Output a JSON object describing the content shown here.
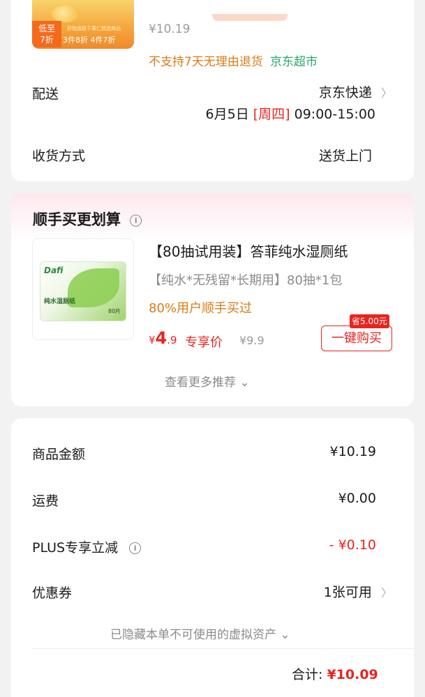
{
  "product": {
    "badge_line1": "低至",
    "badge_line2": "7折",
    "discount_text": "3件8折 4件7折",
    "tiny_text": "好物道路干果仁精选商品",
    "price": "¥10.19",
    "no_return": "不支持7天无理由退货",
    "store": "京东超市"
  },
  "delivery": {
    "label": "配送",
    "carrier": "京东快递",
    "date": "6月5日",
    "weekday": "[周四]",
    "time": "09:00-15:00",
    "method_label": "收货方式",
    "method_value": "送货上门"
  },
  "addon": {
    "section_title": "顺手买更划算",
    "info_icon": "i",
    "brand": "Dafi",
    "pack_text": "纯水湿厕纸",
    "pack_count": "80片",
    "title": "【80抽试用装】答菲纯水湿厕纸",
    "subtitle": "【纯水*无残留*长期用】80抽*1包",
    "stat": "80%用户顺手买过",
    "price_symbol": "¥",
    "price_int": "4",
    "price_dec": ".9",
    "price_label": "专享价",
    "original_price": "¥9.9",
    "buy_label": "一键购买",
    "save_tag": "省5.00元",
    "more_label": "查看更多推荐 ⌄"
  },
  "summary": {
    "goods_label": "商品金额",
    "goods_value": "¥10.19",
    "shipping_label": "运费",
    "shipping_value": "¥0.00",
    "plus_label": "PLUS专享立减",
    "plus_value": "- ¥0.10",
    "coupon_label": "优惠券",
    "coupon_value": "1张可用",
    "hidden_note": "已隐藏本单不可使用的虚拟资产 ⌄",
    "total_label": "合计: ",
    "total_value": "¥10.09"
  },
  "colors": {
    "accent_red": "#e8241e",
    "orange": "#d97b16",
    "green": "#2aa86a"
  }
}
